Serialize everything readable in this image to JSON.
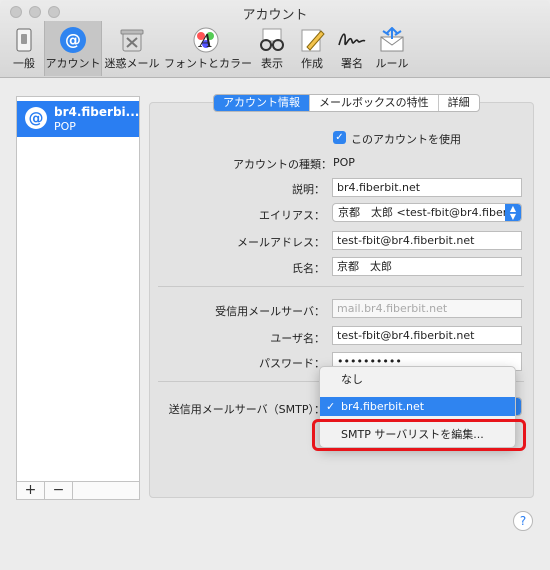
{
  "window": {
    "title": "アカウント"
  },
  "toolbar": {
    "items": [
      {
        "label": "一般",
        "icon": "phone-switch-icon"
      },
      {
        "label": "アカウント",
        "icon": "at-sign-icon"
      },
      {
        "label": "迷惑メール",
        "icon": "junk-trash-icon"
      },
      {
        "label": "フォントとカラー",
        "icon": "font-color-icon"
      },
      {
        "label": "表示",
        "icon": "glasses-icon"
      },
      {
        "label": "作成",
        "icon": "compose-pencil-icon"
      },
      {
        "label": "署名",
        "icon": "signature-icon"
      },
      {
        "label": "ルール",
        "icon": "rules-envelope-icon"
      }
    ]
  },
  "sidebar": {
    "account": {
      "icon_glyph": "@",
      "name": "br4.fiberbi...",
      "type": "POP"
    },
    "add_label": "+",
    "remove_label": "−"
  },
  "tabs": [
    {
      "label": "アカウント情報",
      "selected": true
    },
    {
      "label": "メールボックスの特性",
      "selected": false
    },
    {
      "label": "詳細",
      "selected": false
    }
  ],
  "form": {
    "enable_label": "このアカウントを使用",
    "enable_checked": true,
    "account_type_label": "アカウントの種類：",
    "account_type_value": "POP",
    "description_label": "説明：",
    "description_value": "br4.fiberbit.net",
    "alias_label": "エイリアス：",
    "alias_value": "京都　太郎 <test-fbit@br4.fiberbit.net>",
    "email_label": "メールアドレス：",
    "email_value": "test-fbit@br4.fiberbit.net",
    "name_label": "氏名：",
    "name_value": "京都　太郎",
    "incoming_label": "受信用メールサーバ：",
    "incoming_value": "mail.br4.fiberbit.net",
    "username_label": "ユーザ名：",
    "username_value": "test-fbit@br4.fiberbit.net",
    "password_label": "パスワード：",
    "password_value": "••••••••••",
    "smtp_label": "送信用メールサーバ（SMTP）："
  },
  "smtp_menu": {
    "items": [
      {
        "label": "なし",
        "checked": false,
        "selected": false
      },
      {
        "label": "br4.fiberbit.net",
        "checked": true,
        "selected": true
      },
      {
        "label": "SMTP サーバリストを編集...",
        "checked": false,
        "selected": false
      }
    ],
    "check_glyph": "✓"
  },
  "help": {
    "glyph": "?"
  },
  "colors": {
    "accent": "#2f84f0",
    "highlight": "#e8141a"
  }
}
